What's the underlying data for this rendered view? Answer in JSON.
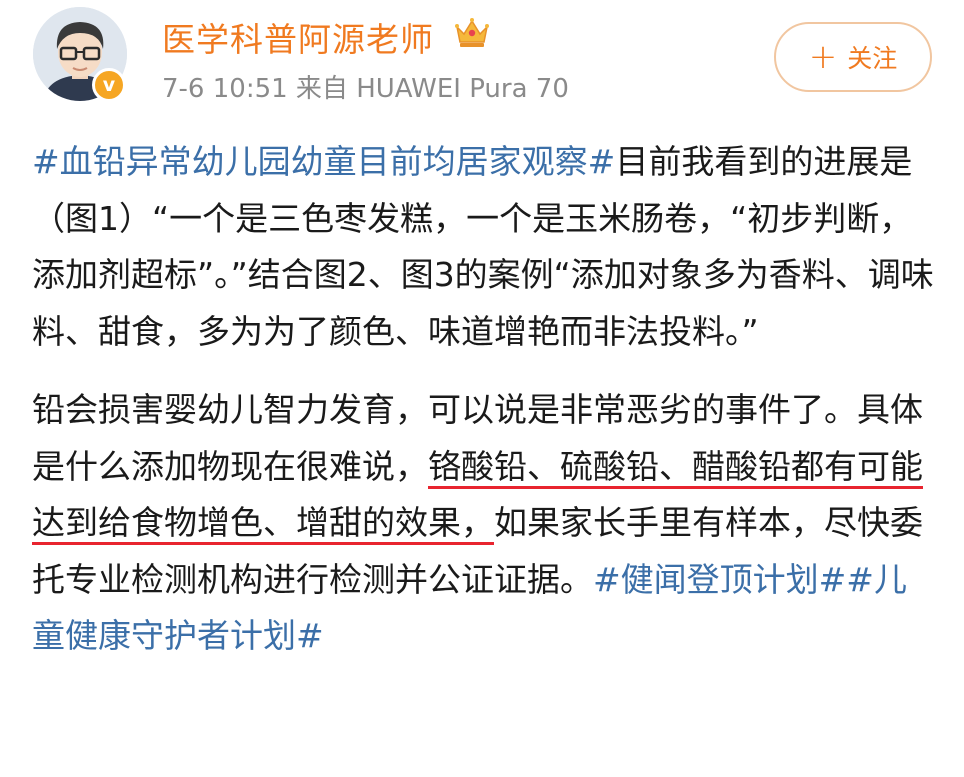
{
  "user": {
    "name": "医学科普阿源老师",
    "verified_badge": "v",
    "crown_icon": "crown-icon"
  },
  "post_meta": {
    "text": "7-6 10:51  来自 HUAWEI Pura 70"
  },
  "follow_button": {
    "plus": "+",
    "label": "关注"
  },
  "content": {
    "p1": {
      "tag": "#血铅异常幼儿园幼童目前均居家观察#",
      "text": "目前我看到的进展是（图1）“一个是三色枣发糕，一个是玉米肠卷，“初步判断，添加剂超标”。”结合图2、图3的案例“添加对象多为香料、调味料、甜食，多为为了颜色、味道增艳而非法投料。”"
    },
    "p2": {
      "text_before": "铅会损害婴幼儿智力发育，可以说是非常恶劣的事件了。具体是什么添加物现在很难说，",
      "underlined": "铬酸铅、硫酸铅、醋酸铅都有可能达到给食物增色、增甜的效果，",
      "text_after": "如果家长手里有样本，尽快委托专业检测机构进行检测并公证证据。",
      "tags": "#健闻登顶计划##儿童健康守护者计划#"
    }
  },
  "colors": {
    "username": "#f07a20",
    "tag": "#3b6fa8",
    "underline": "#e8242f",
    "meta": "#8a8a8a"
  }
}
